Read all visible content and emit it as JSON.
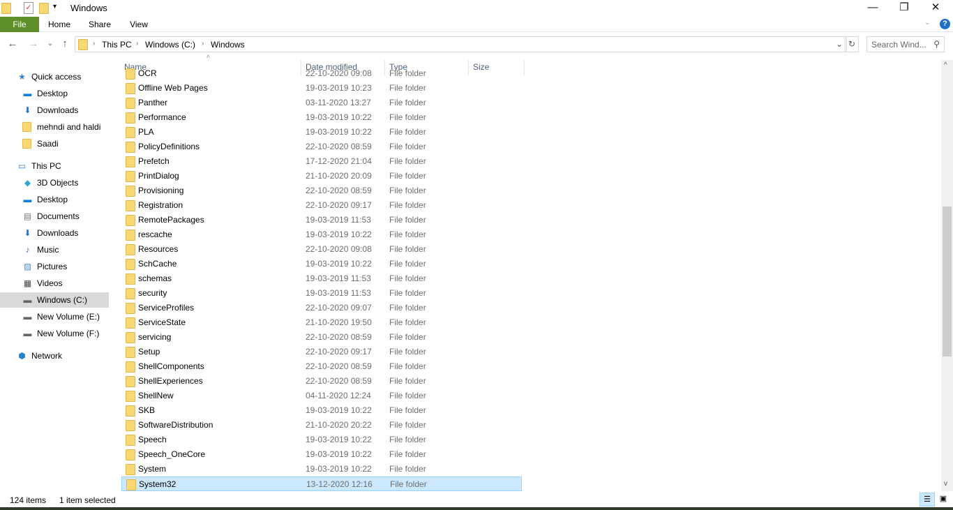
{
  "window": {
    "title": "Windows"
  },
  "ribbon": {
    "tabs": [
      "File",
      "Home",
      "Share",
      "View"
    ]
  },
  "address": {
    "crumbs": [
      "This PC",
      "Windows (C:)",
      "Windows"
    ]
  },
  "search": {
    "placeholder": "Search Wind..."
  },
  "sidebar": {
    "items": [
      {
        "label": "Quick access",
        "icon": "star-icon",
        "indent": 0
      },
      {
        "label": "Desktop",
        "icon": "desktop-icon",
        "indent": 1
      },
      {
        "label": "Downloads",
        "icon": "download-icon",
        "indent": 1
      },
      {
        "label": "mehndi and haldi",
        "icon": "folder-icon",
        "indent": 1
      },
      {
        "label": "Saadi",
        "icon": "folder-icon",
        "indent": 1
      },
      {
        "label": "This PC",
        "icon": "computer-icon",
        "indent": 0
      },
      {
        "label": "3D Objects",
        "icon": "cube-icon",
        "indent": 1
      },
      {
        "label": "Desktop",
        "icon": "desktop-icon",
        "indent": 1
      },
      {
        "label": "Documents",
        "icon": "document-icon",
        "indent": 1
      },
      {
        "label": "Downloads",
        "icon": "download-icon",
        "indent": 1
      },
      {
        "label": "Music",
        "icon": "music-icon",
        "indent": 1
      },
      {
        "label": "Pictures",
        "icon": "picture-icon",
        "indent": 1
      },
      {
        "label": "Videos",
        "icon": "video-icon",
        "indent": 1
      },
      {
        "label": "Windows (C:)",
        "icon": "drive-icon",
        "indent": 1,
        "selected": true
      },
      {
        "label": "New Volume (E:)",
        "icon": "drive-icon",
        "indent": 1
      },
      {
        "label": "New Volume (F:)",
        "icon": "drive-icon",
        "indent": 1
      },
      {
        "label": "Network",
        "icon": "network-icon",
        "indent": 0
      }
    ]
  },
  "columns": [
    "Name",
    "Date modified",
    "Type",
    "Size"
  ],
  "files": [
    {
      "name": "OCR",
      "date": "22-10-2020 09:08",
      "type": "File folder"
    },
    {
      "name": "Offline Web Pages",
      "date": "19-03-2019 10:23",
      "type": "File folder"
    },
    {
      "name": "Panther",
      "date": "03-11-2020 13:27",
      "type": "File folder"
    },
    {
      "name": "Performance",
      "date": "19-03-2019 10:22",
      "type": "File folder"
    },
    {
      "name": "PLA",
      "date": "19-03-2019 10:22",
      "type": "File folder"
    },
    {
      "name": "PolicyDefinitions",
      "date": "22-10-2020 08:59",
      "type": "File folder"
    },
    {
      "name": "Prefetch",
      "date": "17-12-2020 21:04",
      "type": "File folder"
    },
    {
      "name": "PrintDialog",
      "date": "21-10-2020 20:09",
      "type": "File folder"
    },
    {
      "name": "Provisioning",
      "date": "22-10-2020 08:59",
      "type": "File folder"
    },
    {
      "name": "Registration",
      "date": "22-10-2020 09:17",
      "type": "File folder"
    },
    {
      "name": "RemotePackages",
      "date": "19-03-2019 11:53",
      "type": "File folder"
    },
    {
      "name": "rescache",
      "date": "19-03-2019 10:22",
      "type": "File folder"
    },
    {
      "name": "Resources",
      "date": "22-10-2020 09:08",
      "type": "File folder"
    },
    {
      "name": "SchCache",
      "date": "19-03-2019 10:22",
      "type": "File folder"
    },
    {
      "name": "schemas",
      "date": "19-03-2019 11:53",
      "type": "File folder"
    },
    {
      "name": "security",
      "date": "19-03-2019 11:53",
      "type": "File folder"
    },
    {
      "name": "ServiceProfiles",
      "date": "22-10-2020 09:07",
      "type": "File folder"
    },
    {
      "name": "ServiceState",
      "date": "21-10-2020 19:50",
      "type": "File folder"
    },
    {
      "name": "servicing",
      "date": "22-10-2020 08:59",
      "type": "File folder"
    },
    {
      "name": "Setup",
      "date": "22-10-2020 09:17",
      "type": "File folder"
    },
    {
      "name": "ShellComponents",
      "date": "22-10-2020 08:59",
      "type": "File folder"
    },
    {
      "name": "ShellExperiences",
      "date": "22-10-2020 08:59",
      "type": "File folder"
    },
    {
      "name": "ShellNew",
      "date": "04-11-2020 12:24",
      "type": "File folder"
    },
    {
      "name": "SKB",
      "date": "19-03-2019 10:22",
      "type": "File folder"
    },
    {
      "name": "SoftwareDistribution",
      "date": "21-10-2020 20:22",
      "type": "File folder"
    },
    {
      "name": "Speech",
      "date": "19-03-2019 10:22",
      "type": "File folder"
    },
    {
      "name": "Speech_OneCore",
      "date": "19-03-2019 10:22",
      "type": "File folder"
    },
    {
      "name": "System",
      "date": "19-03-2019 10:22",
      "type": "File folder"
    },
    {
      "name": "System32",
      "date": "13-12-2020 12:16",
      "type": "File folder",
      "selected": true
    }
  ],
  "status": {
    "count": "124 items",
    "selected": "1 item selected"
  },
  "colors": {
    "file_tab": "#5f8f2a",
    "selection": "#cce8ff",
    "help": "#1a6fc9"
  }
}
